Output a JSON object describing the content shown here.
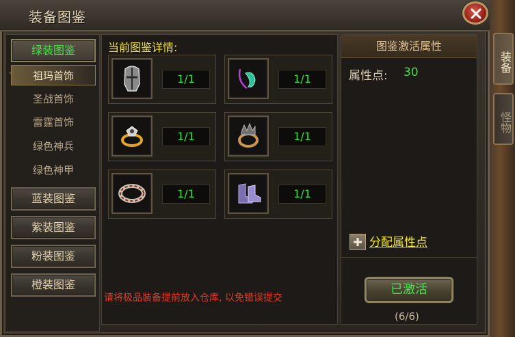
{
  "window": {
    "title": "装备图鉴"
  },
  "side_tabs": [
    {
      "label": "装备",
      "active": true
    },
    {
      "label": "怪物",
      "active": false
    }
  ],
  "categories": {
    "top": {
      "label": "绿装图鉴"
    },
    "sub_items": [
      {
        "label": "祖玛首饰",
        "active": true
      },
      {
        "label": "圣战首饰"
      },
      {
        "label": "雷霆首饰"
      },
      {
        "label": "绿色神兵"
      },
      {
        "label": "绿色神甲"
      }
    ],
    "others": [
      {
        "label": "蓝装图鉴"
      },
      {
        "label": "紫装图鉴"
      },
      {
        "label": "粉装图鉴"
      },
      {
        "label": "橙装图鉴"
      }
    ]
  },
  "details": {
    "title": "当前图鉴详情:",
    "slots": [
      {
        "icon": "helmet-icon",
        "count": "1/1"
      },
      {
        "icon": "necklace-icon",
        "count": "1/1"
      },
      {
        "icon": "ring-icon",
        "count": "1/1"
      },
      {
        "icon": "ring-icon",
        "count": "1/1"
      },
      {
        "icon": "bracelet-icon",
        "count": "1/1"
      },
      {
        "icon": "boots-icon",
        "count": "1/1"
      }
    ],
    "hint": "请将极品装备提前放入仓库, 以免错误提交"
  },
  "activation": {
    "header": "图鉴激活属性",
    "attr_label": "属性点:",
    "attr_value": "30",
    "assign_label": "分配属性点",
    "button_label": "已激活",
    "progress": "(6/6)"
  },
  "colors": {
    "green_text": "#35e23a",
    "yellow_text": "#f2e23a",
    "red_hint": "#e23a2a",
    "close_red": "#9a2418"
  }
}
